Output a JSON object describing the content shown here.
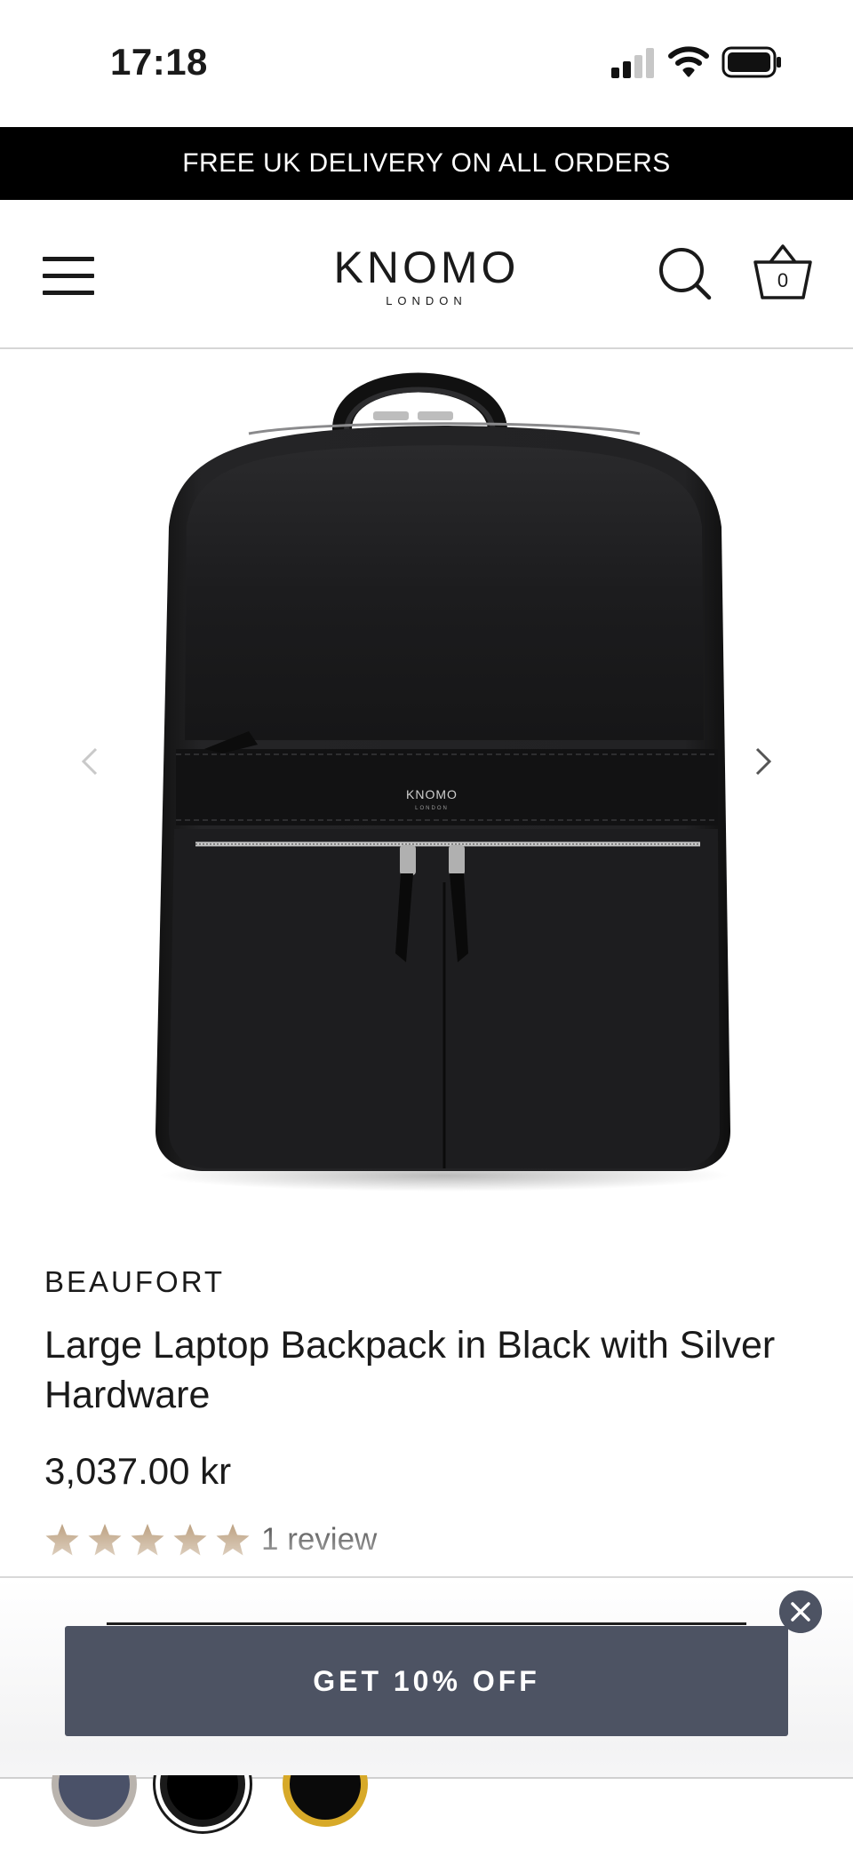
{
  "status_bar": {
    "time": "17:18",
    "icons": [
      "cellular-signal-icon",
      "wifi-icon",
      "battery-icon"
    ]
  },
  "promo_banner": {
    "text": "FREE UK DELIVERY ON ALL ORDERS"
  },
  "header": {
    "menu_icon": "hamburger-menu-icon",
    "logo_main": "KNOMO",
    "logo_sub": "LONDON",
    "search_icon": "search-icon",
    "basket_icon": "basket-icon",
    "basket_count": "0"
  },
  "gallery": {
    "image": "black-backpack-product-photo",
    "image_logo_main": "KNOMO",
    "image_logo_sub": "LONDON",
    "prev_icon": "chevron-left-icon",
    "next_icon": "chevron-right-icon"
  },
  "product": {
    "collection": "BEAUFORT",
    "title": "Large Laptop Backpack in Black with Silver Hardware",
    "price": "3,037.00 kr",
    "rating": 5,
    "rating_max": 5,
    "review_count": "1 review"
  },
  "offer_popup": {
    "button_label": "GET 10% OFF",
    "close_icon": "close-icon"
  },
  "swatches": [
    {
      "color": "#4a5168",
      "ring": "#b9b3ad",
      "name": "navy"
    },
    {
      "color": "#000000",
      "ring": "#1a1a1a",
      "name": "black-selected"
    },
    {
      "color": "#0a0a0a",
      "ring": "#d7a928",
      "name": "black-gold"
    }
  ],
  "colors": {
    "promo_bg": "#000000",
    "star": "#a8845a",
    "offer_button": "#4d5363"
  }
}
